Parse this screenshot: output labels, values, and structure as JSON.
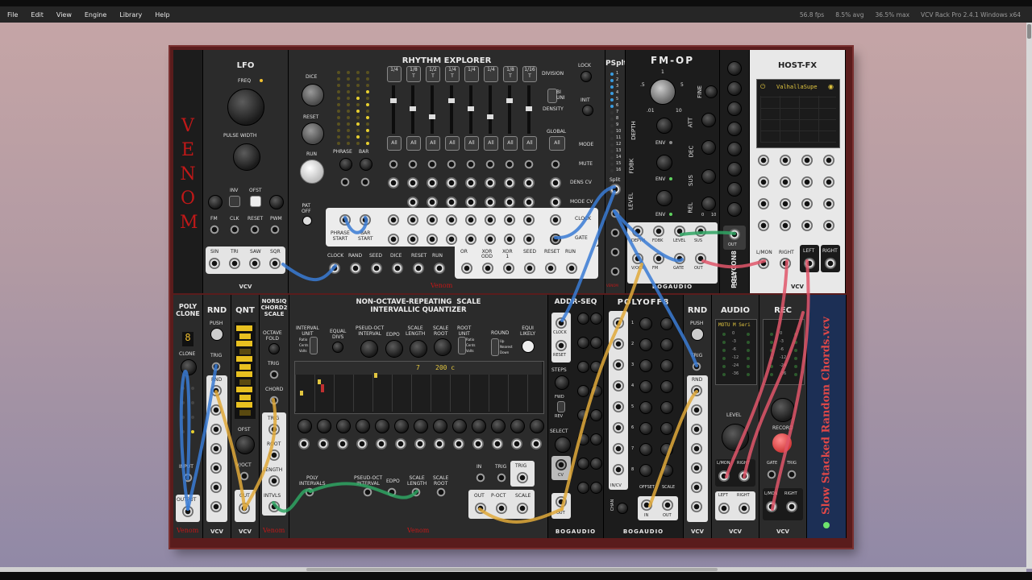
{
  "menu": {
    "items": [
      "File",
      "Edit",
      "View",
      "Engine",
      "Library",
      "Help"
    ]
  },
  "status": {
    "fps": "56.8 fps",
    "avg": "8.5% avg",
    "max": "36.5% max",
    "app": "VCV Rack Pro 2.4.1 Windows x64"
  },
  "modules": {
    "lfo": {
      "title": "LFO",
      "freq": "FREQ",
      "pulse_width": "PULSE WIDTH",
      "inv": "INV",
      "ofst": "OFST",
      "fm": "FM",
      "clk": "CLK",
      "reset": "RESET",
      "pwm": "PWM",
      "outs": [
        "SIN",
        "TRI",
        "SAW",
        "SQR"
      ],
      "brand": "VCV"
    },
    "venom_logo": "Venom",
    "rhythm": {
      "title": "RHYTHM  EXPLORER",
      "division": "DIVISION",
      "lock": "LOCK",
      "init": "INIT",
      "density": "DENSITY",
      "global": "GLOBAL",
      "mode": "MODE",
      "mute": "MUTE",
      "dens_cv": "DENS CV",
      "mode_cv": "MODE CV",
      "clock": "CLOCK",
      "gate": "GATE",
      "dice": "DICE",
      "reset": "RESET",
      "run": "RUN",
      "phrase": "PHRASE",
      "bar": "BAR",
      "pat_off": "PAT\nOFF",
      "bi": "BI",
      "uni": "UNI",
      "phrase_start": "PHRASE\nSTART",
      "bar_start": "BAR\nSTART",
      "divisions": [
        "1/4",
        "1/8\nT",
        "1/2\nT",
        "1/4\nT",
        "1/4",
        "1/4",
        "1/8\nT",
        "1/16\nT"
      ],
      "mode_btn": "All",
      "bottom": [
        "CLOCK",
        "RAND",
        "SEED",
        "DICE",
        "RESET",
        "RUN"
      ],
      "bottom2": [
        "OR",
        "XOR\nODD",
        "XOR\n1",
        "SEED",
        "RESET",
        "RUN"
      ]
    },
    "pspit": {
      "title": "PSplt",
      "split": "Split",
      "brand": "VENOM",
      "numbers": [
        "1",
        "2",
        "3",
        "4",
        "5",
        "6",
        "7",
        "8",
        "9",
        "10",
        "11",
        "12",
        "13",
        "14",
        "15",
        "16"
      ]
    },
    "fmop": {
      "title": "FM-OP",
      "ratio_marks": [
        ".5",
        "1",
        "5",
        ".01",
        "10"
      ],
      "fine": "FINE",
      "depth": "DEPTH",
      "env": "ENV",
      "att": "ATT",
      "fdbk": "FDBK",
      "dec": "DEC",
      "level": "LEVEL",
      "sus": "SUS",
      "rel": "REL",
      "jacks1": [
        "DEPTH",
        "FDBK",
        "LEVEL",
        "SUS"
      ],
      "jacks2": [
        "V/OCT",
        "FM",
        "GATE",
        "OUT"
      ],
      "zero": "0",
      "ten": "10",
      "brand": "BOGAUDIO"
    },
    "polycon": {
      "title": "POLYCON8",
      "brand": "BGA",
      "out": "OUT"
    },
    "hostfx": {
      "title": "HOST-FX",
      "plugin": "ValhallaSupe",
      "lmon": "L/MON",
      "right": "RIGHT",
      "left": "LEFT",
      "right2": "RIGHT",
      "brand": "VCV"
    },
    "polyclone": {
      "title": "POLY\nCLONE",
      "display": "8",
      "clone": "CLONE",
      "input": "INPUT",
      "output": "OUTPUT"
    },
    "rnd": {
      "title": "RND",
      "push": "PUSH",
      "trig": "TRIG",
      "rnd": "RND",
      "brand": "VCV"
    },
    "qnt": {
      "title": "QNT",
      "ofst": "OFST",
      "voct": "V/OCT",
      "out": "OUT",
      "brand": "VCV"
    },
    "norsiq": {
      "title": "NORSIQ\nCHORD2\nSCALE",
      "octave_fold": "OCTAVE\nFOLD",
      "trig": "TRIG",
      "chord": "CHORD",
      "root": "ROOT",
      "length": "LENGTH",
      "intvls": "INTVLS"
    },
    "quant": {
      "title": "NON-OCTAVE-REPEATING  SCALE\nINTERVALLIC QUANTIZER",
      "interval_unit": "INTERVAL\nUNIT",
      "equal_divs": "EQUAL\nDIVS",
      "pseud_oct": "PSEUD-OCT\nINTERVAL",
      "edpo": "EDPO",
      "scale_length": "SCALE\nLENGTH",
      "scale_root": "SCALE\nROOT",
      "root_unit": "ROOT\nUNIT",
      "round": "ROUND",
      "equi_likely": "EQUI\nLIKELY",
      "display_a": "7",
      "display_b": "200 c",
      "ratio": "Ratio",
      "cents": "Cents",
      "volts": "Volts",
      "up": "Up",
      "nearest": "Nearest",
      "down": "Down",
      "poly_intervals": "POLY\nINTERVALS",
      "in": "IN",
      "trig": "TRIG",
      "out": "OUT",
      "poct": "P-OCT",
      "scale": "SCALE",
      "brand": "Venom"
    },
    "addr": {
      "title": "ADDR-SEQ",
      "clock": "CLOCK",
      "reset": "RESET",
      "steps": "STEPS",
      "fwd": "FWD",
      "rev": "REV",
      "select": "SELECT",
      "cv": "CV",
      "out": "OUT",
      "brand": "BOGAUDIO"
    },
    "polyoff": {
      "title": "POLYOFF8",
      "chan": "CHAN",
      "offset": "OFFSET",
      "scale": "SCALE",
      "in_cv": "IN/CV",
      "in": "IN",
      "out": "OUT",
      "brand": "BOGAUDIO",
      "rows": [
        "1",
        "2",
        "3",
        "4",
        "5",
        "6",
        "7",
        "8"
      ]
    },
    "rnd2": {
      "title": "RND",
      "push": "PUSH",
      "trig": "TRIG",
      "rnd": "RND",
      "brand": "VCV"
    },
    "audio": {
      "title": "AUDIO",
      "device": "MOTU M Seri",
      "level": "LEVEL",
      "lmon": "L/MON",
      "right": "RIGHT",
      "left": "LEFT",
      "right2": "RIGHT",
      "db": [
        "0",
        "-3",
        "-6",
        "-12",
        "-24",
        "-36"
      ],
      "brand": "VCV"
    },
    "rec": {
      "title": "REC",
      "record": "RECORD",
      "gate": "GATE",
      "trig": "TRIG",
      "lmon": "L/MON",
      "right": "RIGHT",
      "db": [
        "0",
        "-3",
        "-6",
        "-12",
        "-24",
        "-36"
      ],
      "brand": "VCV"
    },
    "notes": {
      "text": "Slow Stacked Random Chords.vcv"
    }
  }
}
